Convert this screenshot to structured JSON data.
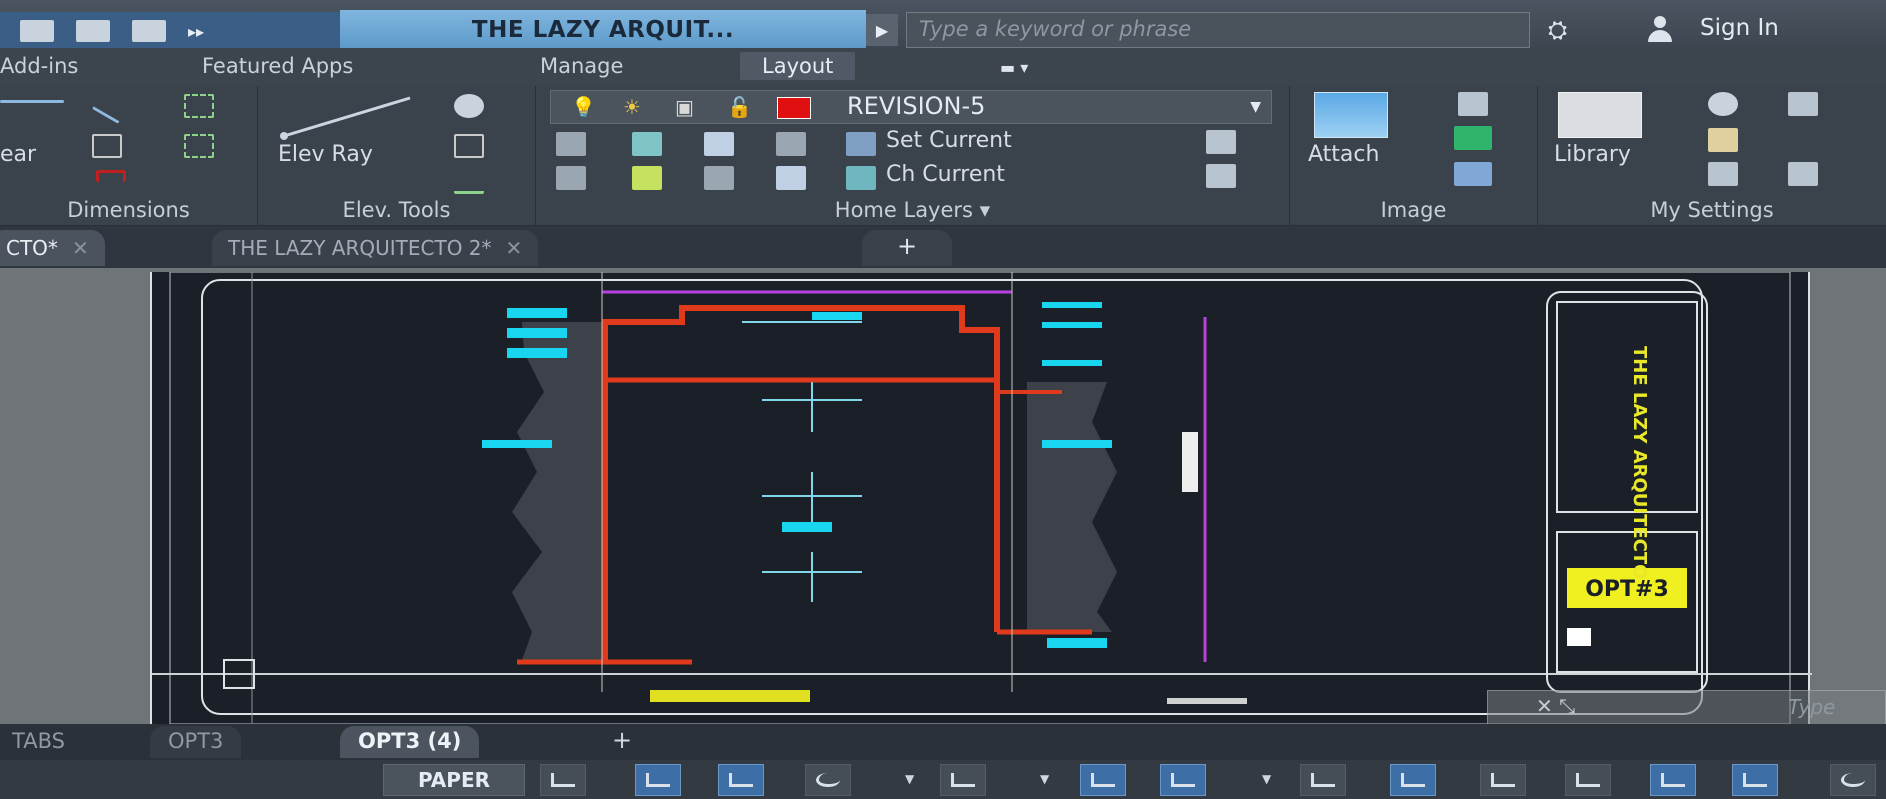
{
  "titlebar": {
    "document_title": "THE LAZY ARQUIT...",
    "search_placeholder": "Type a keyword or phrase",
    "sign_in": "Sign In"
  },
  "menu": {
    "items": [
      "Add-ins",
      "Featured Apps",
      "Manage",
      "Layout"
    ],
    "active": "Layout"
  },
  "ribbon": {
    "dimensions": {
      "label": "Dimensions",
      "linear": "ear"
    },
    "elev_tools": {
      "label": "Elev. Tools",
      "elev_ray": "Elev Ray"
    },
    "home_layers": {
      "label": "Home Layers",
      "current_layer": "REVISION-5",
      "layer_color": "#e01010",
      "set_current": "Set Current",
      "ch_current": "Ch Current"
    },
    "image": {
      "label": "Image",
      "attach": "Attach"
    },
    "my_settings": {
      "label": "My Settings",
      "library": "Library"
    }
  },
  "file_tabs": [
    {
      "label": "CTO*",
      "active": true
    },
    {
      "label": "THE LAZY ARQUITECTO 2*",
      "active": false
    }
  ],
  "drawing": {
    "title_block_text": "THE LAZY ARQUITECTO",
    "sheet_label": "OPT#3"
  },
  "layout_tabs": [
    {
      "label": "TABS",
      "active": false
    },
    {
      "label": "OPT3",
      "active": false
    },
    {
      "label": "OPT3 (4)",
      "active": true
    }
  ],
  "status": {
    "space": "PAPER"
  },
  "command_line": {
    "placeholder": "Type"
  }
}
